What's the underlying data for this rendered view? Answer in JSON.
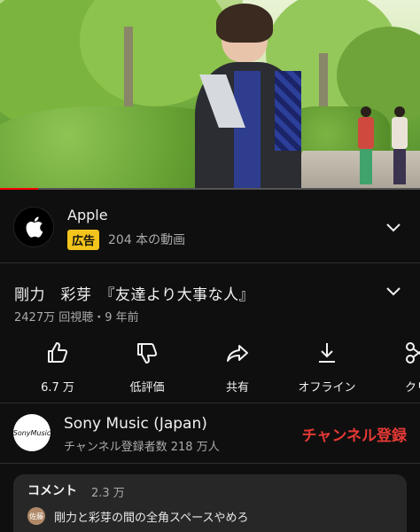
{
  "ad": {
    "title": "Apple",
    "badge": "広告",
    "subtitle": "204 本の動画"
  },
  "video": {
    "title": "剛力　彩芽　『友達より大事な人』",
    "meta": "2427万 回視聴・9 年前",
    "progress": 0.09
  },
  "actions": [
    {
      "icon": "thumbs-up-icon",
      "label": "6.7 万"
    },
    {
      "icon": "thumbs-down-icon",
      "label": "低評価"
    },
    {
      "icon": "share-icon",
      "label": "共有"
    },
    {
      "icon": "download-icon",
      "label": "オフライン"
    },
    {
      "icon": "clip-icon",
      "label": "クリ"
    }
  ],
  "channel": {
    "name": "Sony Music (Japan)",
    "avatar_text": "SonyMusic",
    "subscribers": "チャンネル登録者数 218 万人",
    "subscribe_label": "チャンネル登録"
  },
  "comments": {
    "header": "コメント",
    "count": "2.3 万",
    "top": {
      "avatar_text": "佐藤",
      "text": "剛力と彩芽の間の全角スペースやめろ"
    }
  },
  "colors": {
    "background": "#0f0f0f",
    "accent_red": "#e53935",
    "ad_badge": "#f2c41c",
    "progress": "#ff0000"
  }
}
